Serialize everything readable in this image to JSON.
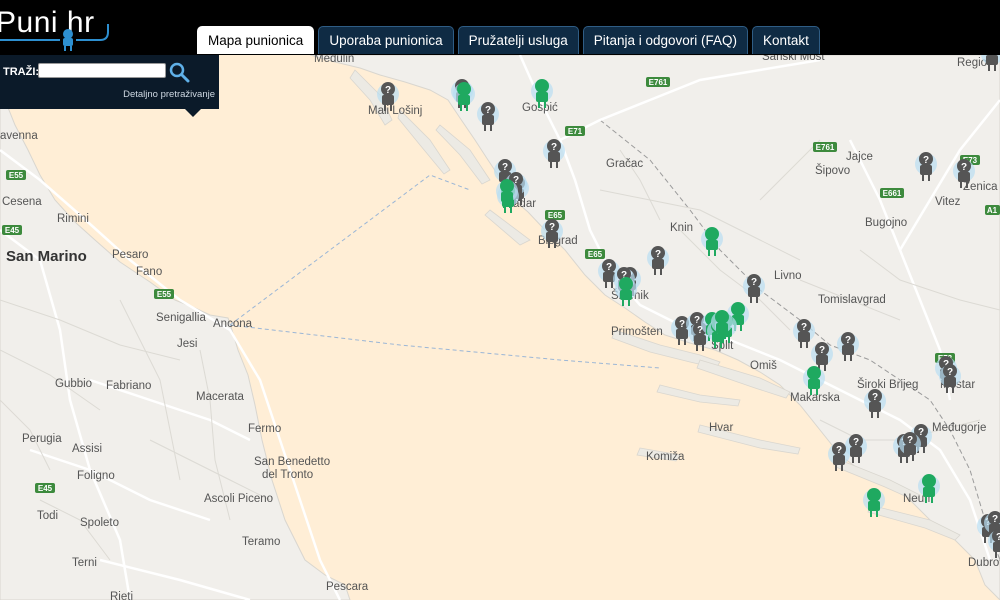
{
  "header": {
    "logo_text": "Puni hr",
    "tabs": [
      {
        "label": "Mapa punionica",
        "active": true
      },
      {
        "label": "Uporaba punionica",
        "active": false
      },
      {
        "label": "Pružatelji usluga",
        "active": false
      },
      {
        "label": "Pitanja i odgovori (FAQ)",
        "active": false
      },
      {
        "label": "Kontakt",
        "active": false
      }
    ]
  },
  "search": {
    "label": "TRAŽI:",
    "value": "",
    "placeholder": "",
    "advanced_link": "Detaljno pretraživanje"
  },
  "map": {
    "labels": [
      {
        "text": "San Marino",
        "style": "big"
      },
      {
        "text": "Cesena"
      },
      {
        "text": "Rimini"
      },
      {
        "text": "Pesaro"
      },
      {
        "text": "Fano"
      },
      {
        "text": "Senigallia"
      },
      {
        "text": "Ancona"
      },
      {
        "text": "Jesi"
      },
      {
        "text": "Gubbio"
      },
      {
        "text": "Fabriano"
      },
      {
        "text": "Macerata"
      },
      {
        "text": "Perugia"
      },
      {
        "text": "Assisi"
      },
      {
        "text": "Foligno"
      },
      {
        "text": "Fermo"
      },
      {
        "text": "San Benedetto"
      },
      {
        "text": "del Tronto"
      },
      {
        "text": "Ascoli Piceno"
      },
      {
        "text": "Spoleto"
      },
      {
        "text": "Todi"
      },
      {
        "text": "Terni"
      },
      {
        "text": "Teramo"
      },
      {
        "text": "Pescara"
      },
      {
        "text": "Rieti"
      },
      {
        "text": "avenna"
      },
      {
        "text": "Mali Lošinj"
      },
      {
        "text": "Gospić"
      },
      {
        "text": "Gračac"
      },
      {
        "text": "Knin"
      },
      {
        "text": "Primošten"
      },
      {
        "text": "Omiš"
      },
      {
        "text": "Makarska"
      },
      {
        "text": "Hvar"
      },
      {
        "text": "Komiža"
      },
      {
        "text": "Livno"
      },
      {
        "text": "Tomislavgrad"
      },
      {
        "text": "Široki Brijeg"
      },
      {
        "text": "Mostar"
      },
      {
        "text": "Međugorje"
      },
      {
        "text": "Bugojno"
      },
      {
        "text": "Jajce"
      },
      {
        "text": "Šipovo"
      },
      {
        "text": "Vitez"
      },
      {
        "text": "Zenica"
      },
      {
        "text": "Neum"
      },
      {
        "text": "Dubrovnik"
      },
      {
        "text": "Sanski Most"
      },
      {
        "text": "Medulin"
      },
      {
        "text": "Šibenik"
      },
      {
        "text": "Zadar"
      },
      {
        "text": "Biograd"
      },
      {
        "text": "Split"
      },
      {
        "text": "Regio"
      }
    ],
    "road_shields": [
      "E55",
      "E45",
      "E55",
      "E45",
      "E65",
      "E71",
      "E761",
      "E65",
      "E761",
      "E661",
      "E73",
      "A1",
      "E73"
    ],
    "marker_counts": {
      "available": 14,
      "unknown": 33
    },
    "colors": {
      "sea": "#ffeed6",
      "land": "#f2f0ec",
      "available_marker": "#1fa960",
      "unknown_marker": "#555555",
      "marker_halo": "#b9def2",
      "tab_bg": "#0f2b44",
      "header_bg": "#000000"
    }
  }
}
